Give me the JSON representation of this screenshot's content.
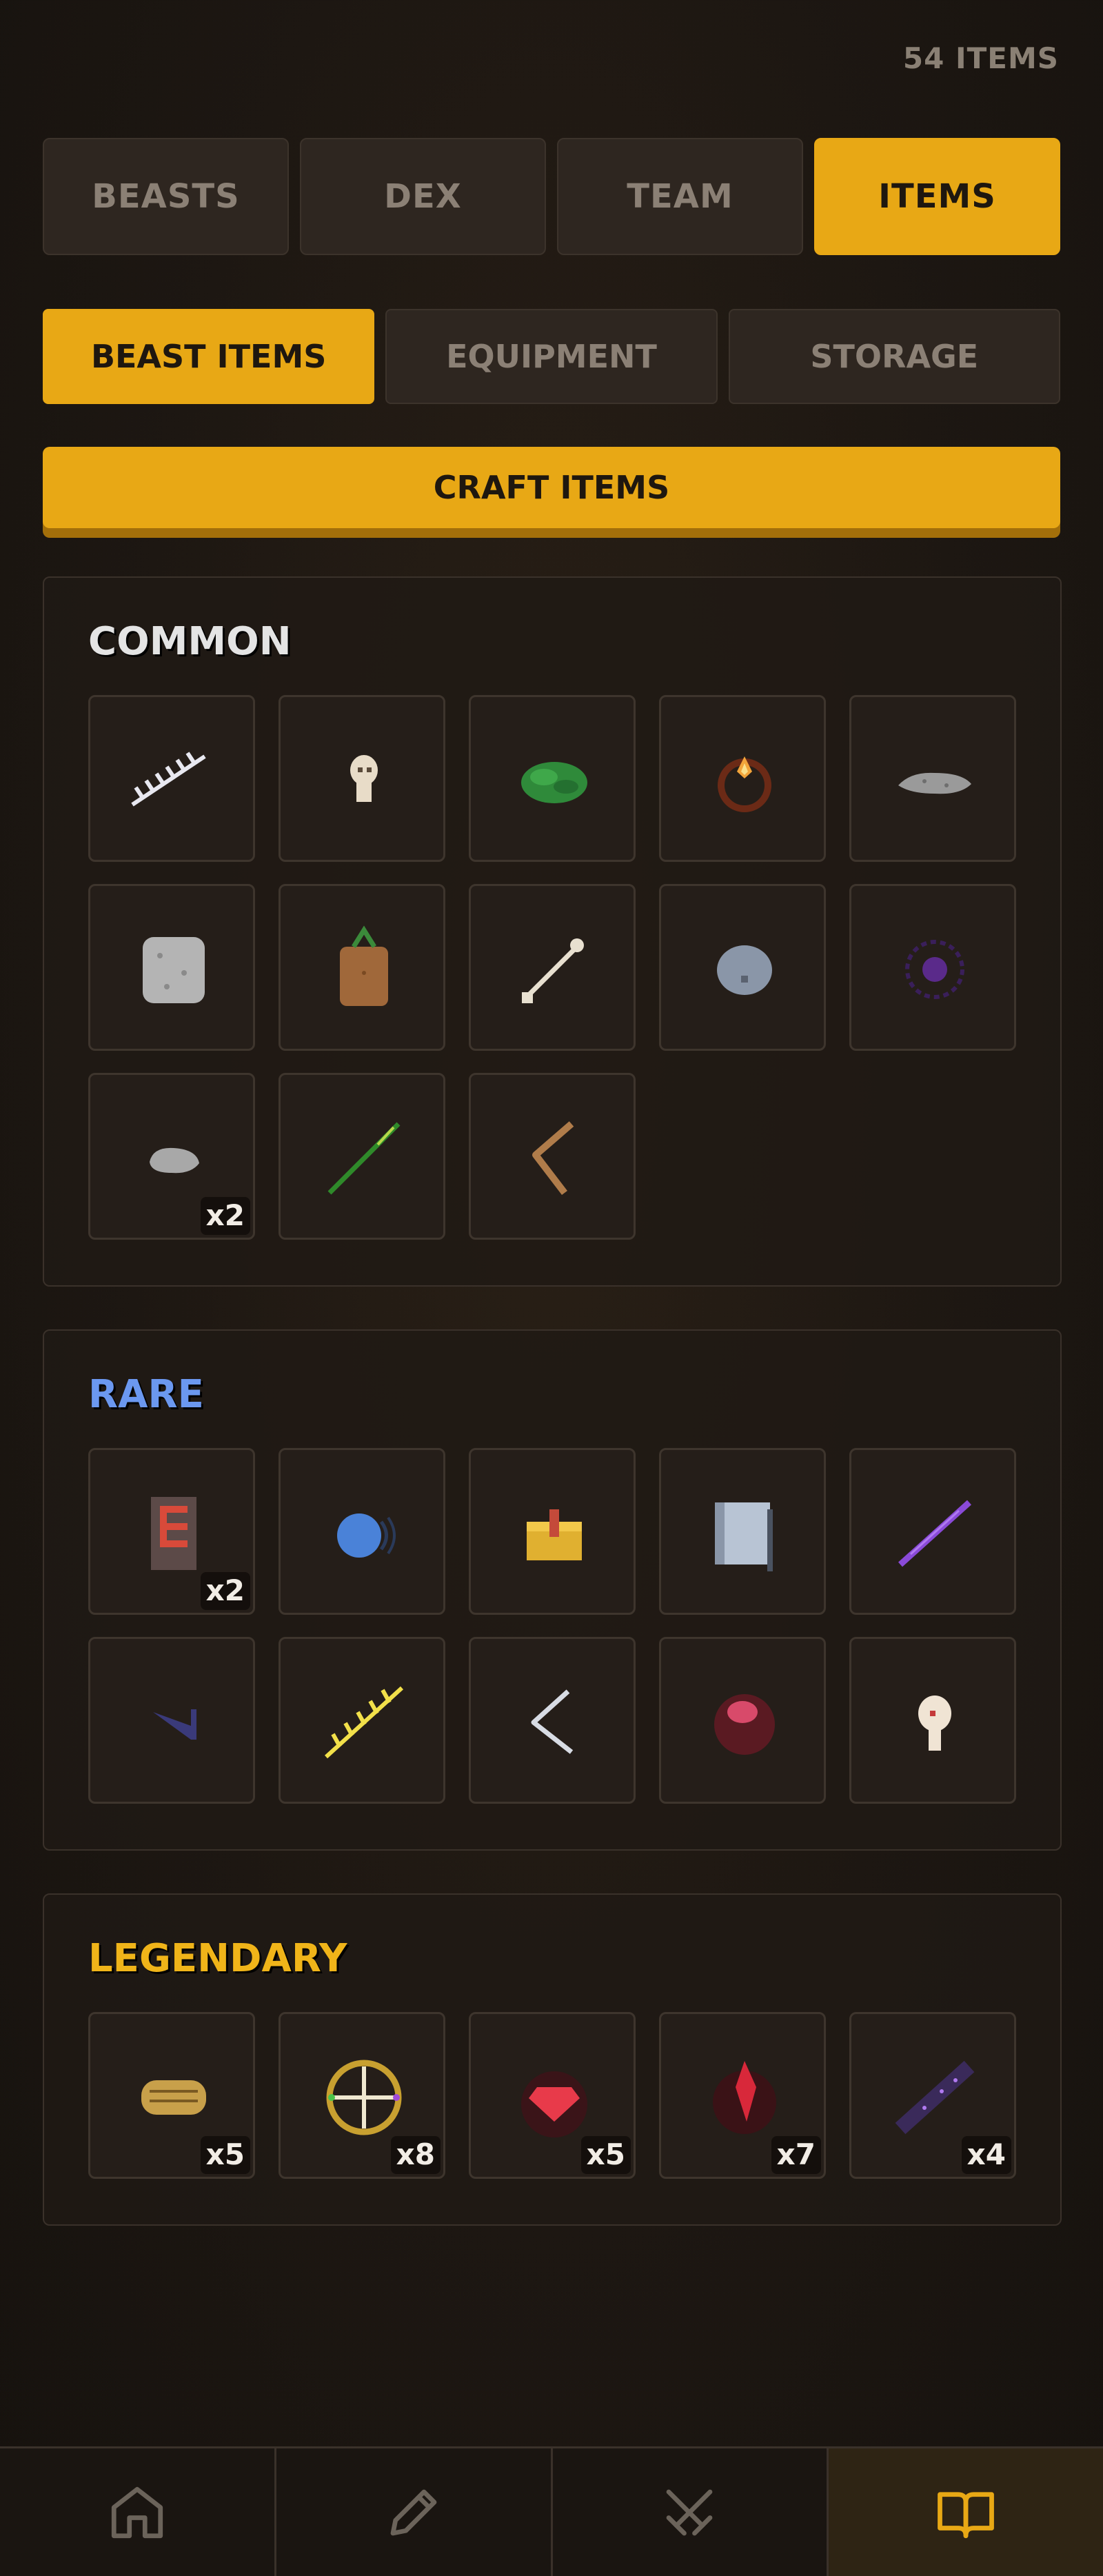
{
  "header": {
    "item_count": "54 ITEMS"
  },
  "tabs": [
    {
      "label": "BEASTS",
      "active": false
    },
    {
      "label": "DEX",
      "active": false
    },
    {
      "label": "TEAM",
      "active": false
    },
    {
      "label": "ITEMS",
      "active": true
    }
  ],
  "subtabs": [
    {
      "label": "BEAST ITEMS",
      "active": true
    },
    {
      "label": "EQUIPMENT",
      "active": false
    },
    {
      "label": "STORAGE",
      "active": false
    }
  ],
  "craft_label": "CRAFT ITEMS",
  "colors": {
    "accent": "#e8a815",
    "common_title": "#e4e4e4",
    "rare_title": "#6b98f0",
    "legendary_title": "#f0b419"
  },
  "sections": {
    "common": {
      "title": "COMMON",
      "items": [
        {
          "icon": "bone-comb-icon",
          "qty": ""
        },
        {
          "icon": "small-skull-icon",
          "qty": ""
        },
        {
          "icon": "green-moss-icon",
          "qty": ""
        },
        {
          "icon": "fire-ring-icon",
          "qty": ""
        },
        {
          "icon": "grey-stone-slab-icon",
          "qty": ""
        },
        {
          "icon": "stone-block-icon",
          "qty": ""
        },
        {
          "icon": "sprout-sack-icon",
          "qty": ""
        },
        {
          "icon": "key-wand-icon",
          "qty": ""
        },
        {
          "icon": "grey-pebble-icon",
          "qty": ""
        },
        {
          "icon": "shadow-swirl-icon",
          "qty": ""
        },
        {
          "icon": "small-rock-icon",
          "qty": "x2"
        },
        {
          "icon": "green-stick-icon",
          "qty": ""
        },
        {
          "icon": "wooden-boomerang-icon",
          "qty": ""
        }
      ]
    },
    "rare": {
      "title": "RARE",
      "items": [
        {
          "icon": "rune-tablet-icon",
          "qty": "x2"
        },
        {
          "icon": "blue-orb-icon",
          "qty": ""
        },
        {
          "icon": "gold-chest-icon",
          "qty": ""
        },
        {
          "icon": "metal-scroll-icon",
          "qty": ""
        },
        {
          "icon": "purple-wand-icon",
          "qty": ""
        },
        {
          "icon": "dark-shard-icon",
          "qty": ""
        },
        {
          "icon": "lightning-spine-icon",
          "qty": ""
        },
        {
          "icon": "silver-hook-icon",
          "qty": ""
        },
        {
          "icon": "crimson-orb-icon",
          "qty": ""
        },
        {
          "icon": "blood-skull-icon",
          "qty": ""
        }
      ]
    },
    "legendary": {
      "title": "LEGENDARY",
      "items": [
        {
          "icon": "golden-scroll-icon",
          "qty": "x5"
        },
        {
          "icon": "golden-compass-icon",
          "qty": "x8"
        },
        {
          "icon": "ruby-heart-icon",
          "qty": "x5"
        },
        {
          "icon": "fire-crystal-icon",
          "qty": "x7"
        },
        {
          "icon": "void-blade-icon",
          "qty": "x4"
        }
      ]
    }
  },
  "nav": [
    {
      "icon": "home-icon",
      "active": false
    },
    {
      "icon": "pencil-icon",
      "active": false
    },
    {
      "icon": "crossed-swords-icon",
      "active": false
    },
    {
      "icon": "open-book-icon",
      "active": true
    }
  ]
}
